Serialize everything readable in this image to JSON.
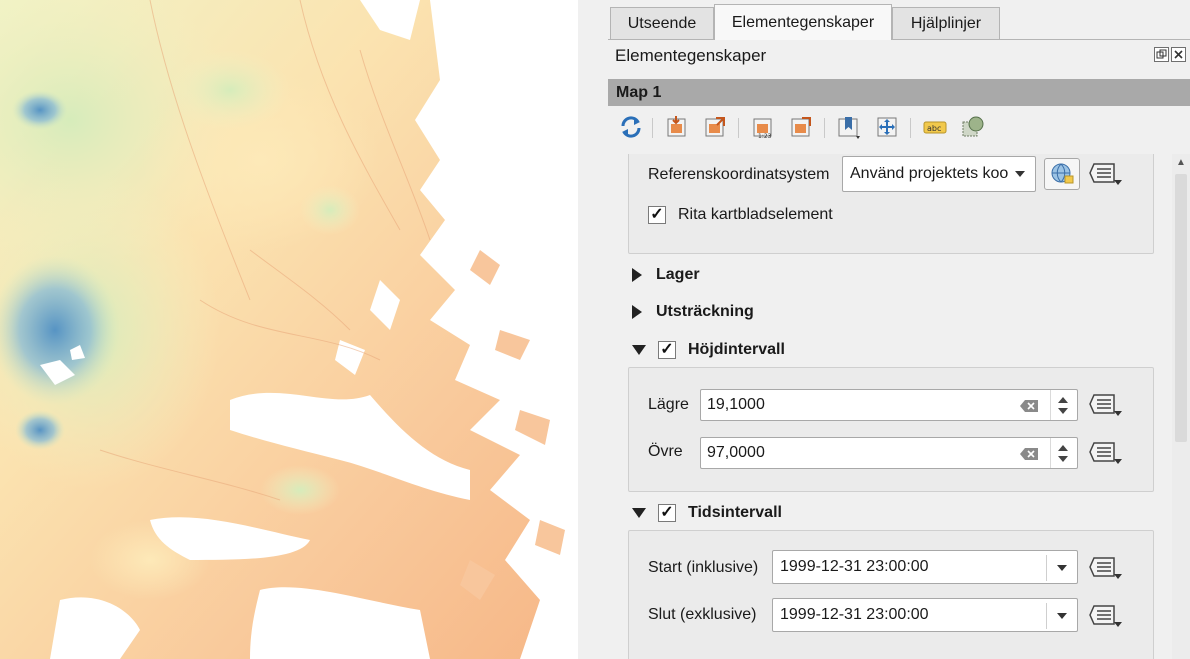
{
  "tabs": [
    {
      "label": "Utseende",
      "active": false
    },
    {
      "label": "Elementegenskaper",
      "active": true
    },
    {
      "label": "Hjälplinjer",
      "active": false
    }
  ],
  "dock": {
    "title": "Elementegenskaper",
    "float_icon": "float-icon",
    "close_icon": "close-icon"
  },
  "item_header": "Map 1",
  "toolbar": {
    "icons": [
      "refresh-icon",
      "set-map-extent-icon",
      "view-extent-icon",
      "set-scale-icon",
      "view-scale-icon",
      "bookmark-icon",
      "move-content-icon",
      "label-settings-icon",
      "clip-settings-icon"
    ]
  },
  "crs": {
    "label": "Referenskoordinatsystem",
    "value": "Använd projektets koo",
    "select_icon": "globe-crs-icon"
  },
  "draw_items": {
    "label": "Rita kartbladselement",
    "checked": true
  },
  "sections": {
    "layers": "Lager",
    "extent": "Utsträckning",
    "elevation": {
      "title": "Höjdintervall",
      "checked": true
    },
    "temporal": {
      "title": "Tidsintervall",
      "checked": true
    }
  },
  "elevation_range": {
    "lower_label": "Lägre",
    "lower_value": "19,1000",
    "upper_label": "Övre",
    "upper_value": "97,0000"
  },
  "temporal_range": {
    "start_label": "Start (inklusive)",
    "start_value": "1999-12-31 23:00:00",
    "end_label": "Slut (exklusive)",
    "end_value": "1999-12-31 23:00:00"
  },
  "colors": {
    "header_bar": "#a9a9a9",
    "panel_bg": "#f0f0f0",
    "map_low": "#f7b98a",
    "map_mid": "#fde6b4",
    "map_green": "#dfeebc",
    "map_high": "#5b98c8"
  }
}
